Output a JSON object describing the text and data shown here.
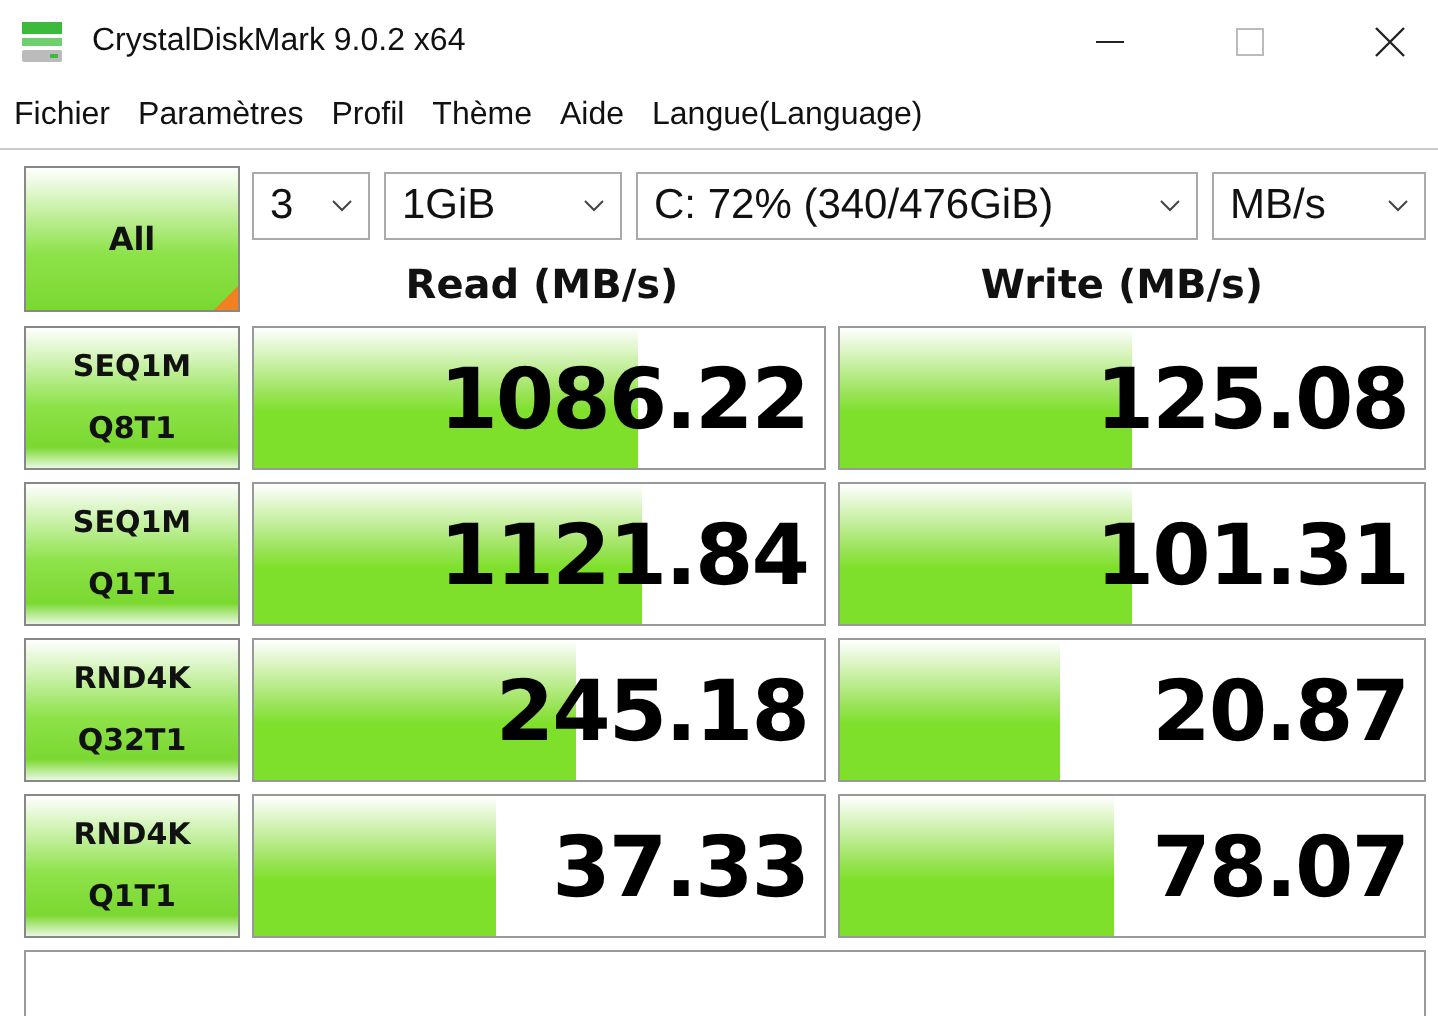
{
  "window": {
    "title": "CrystalDiskMark 9.0.2 x64"
  },
  "menu": [
    "Fichier",
    "Paramètres",
    "Profil",
    "Thème",
    "Aide",
    "Langue(Language)"
  ],
  "all_button": {
    "label": "All"
  },
  "selects": [
    {
      "value": "3"
    },
    {
      "value": "1GiB"
    },
    {
      "value": "C: 72% (340/476GiB)"
    },
    {
      "value": "MB/s"
    }
  ],
  "headers": {
    "read": "Read (MB/s)",
    "write": "Write (MB/s)"
  },
  "tests": [
    {
      "line1": "SEQ1M",
      "line2": "Q8T1",
      "read": {
        "value": "1086.22",
        "level": 0.675
      },
      "write": {
        "value": "125.08",
        "level": 0.5
      }
    },
    {
      "line1": "SEQ1M",
      "line2": "Q1T1",
      "read": {
        "value": "1121.84",
        "level": 0.68
      },
      "write": {
        "value": "101.31",
        "level": 0.5
      }
    },
    {
      "line1": "RND4K",
      "line2": "Q32T1",
      "read": {
        "value": "245.18",
        "level": 0.565
      },
      "write": {
        "value": "20.87",
        "level": 0.375
      }
    },
    {
      "line1": "RND4K",
      "line2": "Q1T1",
      "read": {
        "value": "37.33",
        "level": 0.425
      },
      "write": {
        "value": "78.07",
        "level": 0.47
      }
    }
  ]
}
